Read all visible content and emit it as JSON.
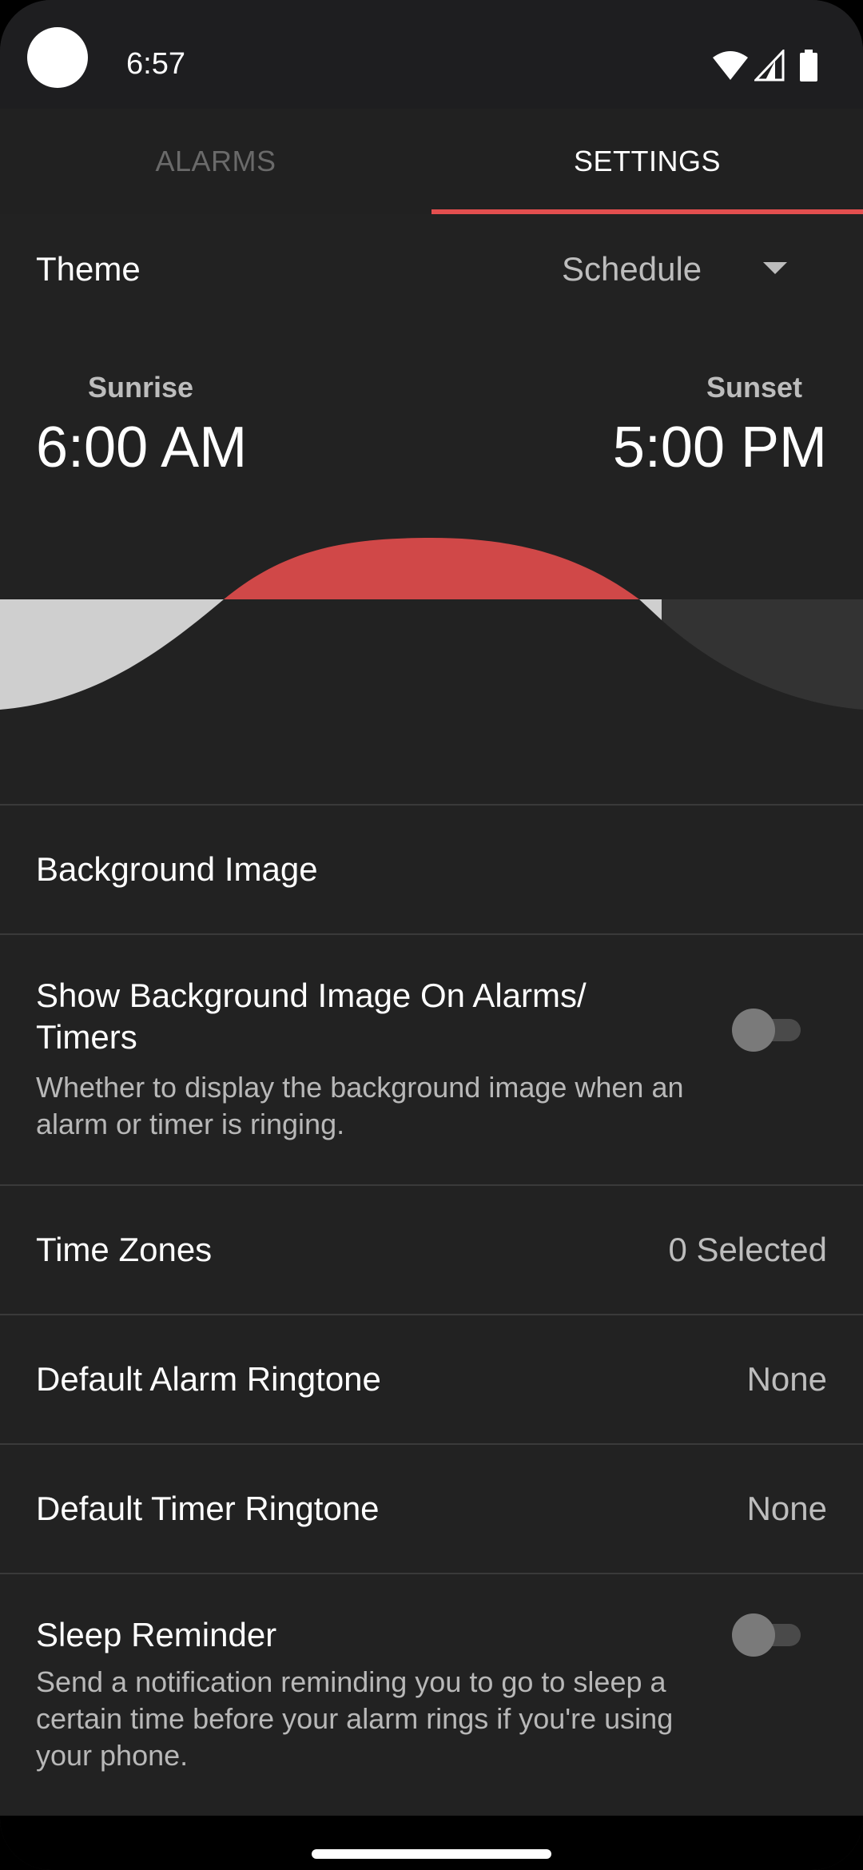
{
  "status_bar": {
    "time": "6:57"
  },
  "tabs": [
    {
      "label": "ALARMS",
      "selected": false
    },
    {
      "label": "SETTINGS",
      "selected": true
    }
  ],
  "theme": {
    "label": "Theme",
    "value": "Schedule"
  },
  "schedule": {
    "sunrise_label": "Sunrise",
    "sunrise_time": "6:00 AM",
    "sunset_label": "Sunset",
    "sunset_time": "5:00 PM"
  },
  "settings": {
    "background_image": {
      "title": "Background Image"
    },
    "show_bg_on_alarms": {
      "title": "Show Background Image On Alarms/ Timers",
      "subtitle": "Whether to display the background image when an alarm or timer is ringing.",
      "enabled": false
    },
    "time_zones": {
      "title": "Time Zones",
      "value": "0 Selected"
    },
    "default_alarm_ringtone": {
      "title": "Default Alarm Ringtone",
      "value": "None"
    },
    "default_timer_ringtone": {
      "title": "Default Timer Ringtone",
      "value": "None"
    },
    "sleep_reminder": {
      "title": "Sleep Reminder",
      "subtitle": "Send a notification reminding you to go to sleep a certain time before your alarm rings if you're using your phone.",
      "enabled": false
    }
  },
  "colors": {
    "accent": "#e34f4f",
    "day_fill": "#d04848",
    "morning_fill": "#cfcfcf",
    "evening_fill": "#333333",
    "background": "#222222"
  },
  "icons": {
    "wifi": "wifi-icon",
    "signal": "cell-signal-icon",
    "battery": "battery-icon",
    "dropdown": "dropdown-arrow-icon"
  }
}
